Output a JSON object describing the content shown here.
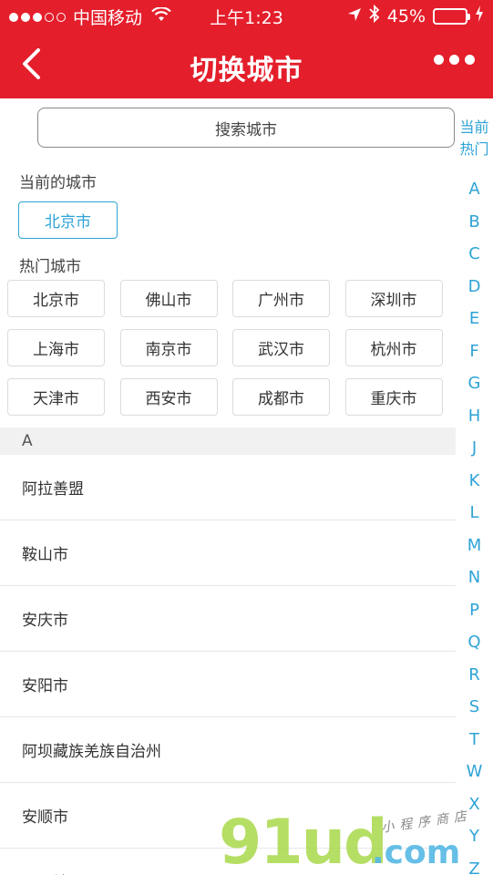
{
  "status_bar": {
    "carrier": "中国移动",
    "time": "上午1:23",
    "battery": "45%",
    "battery_level": 0.45
  },
  "nav": {
    "title": "切换城市"
  },
  "search": {
    "placeholder": "搜索城市"
  },
  "current": {
    "label": "当前的城市",
    "city": "北京市"
  },
  "hot": {
    "label": "热门城市",
    "cities": [
      "北京市",
      "佛山市",
      "广州市",
      "深圳市",
      "上海市",
      "南京市",
      "武汉市",
      "杭州市",
      "天津市",
      "西安市",
      "成都市",
      "重庆市"
    ]
  },
  "list": {
    "letter": "A",
    "cities": [
      "阿拉善盟",
      "鞍山市",
      "安庆市",
      "安阳市",
      "阿坝藏族羌族自治州",
      "安顺市",
      "阿里地区"
    ]
  },
  "index_bar": {
    "top": [
      "当前",
      "热门"
    ],
    "letters": [
      "A",
      "B",
      "C",
      "D",
      "E",
      "F",
      "G",
      "H",
      "J",
      "K",
      "L",
      "M",
      "N",
      "P",
      "Q",
      "R",
      "S",
      "T",
      "W",
      "X",
      "Y",
      "Z"
    ]
  },
  "watermark": {
    "main": "91ud",
    "com": ".com",
    "sub": "小程序商店"
  },
  "colors": {
    "accent": "#e41e2b",
    "link": "#2ea3d6"
  }
}
